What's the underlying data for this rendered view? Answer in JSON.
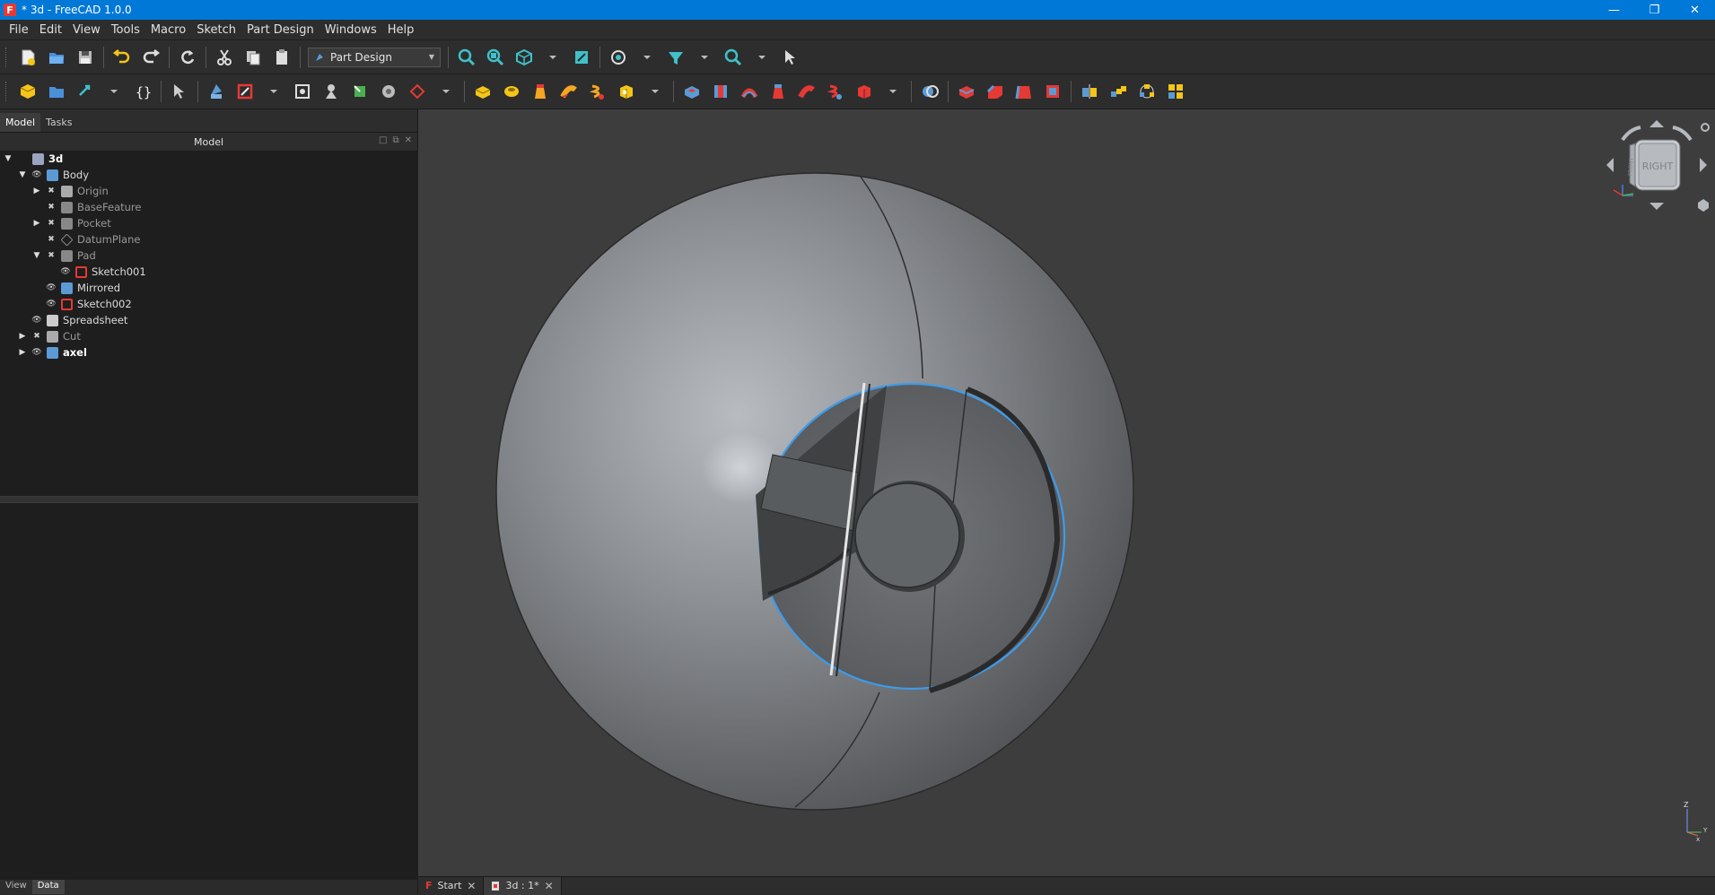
{
  "window": {
    "title": "* 3d - FreeCAD 1.0.0",
    "app_icon": "F",
    "min": "—",
    "restore": "❐",
    "close": "✕"
  },
  "menu": [
    "File",
    "Edit",
    "View",
    "Tools",
    "Macro",
    "Sketch",
    "Part Design",
    "Windows",
    "Help"
  ],
  "toolbar": {
    "workbench": "Part Design",
    "workbench_arrow": "▼"
  },
  "panel": {
    "tabs": [
      "Model",
      "Tasks"
    ],
    "title": "Model",
    "header_buttons": [
      "□",
      "⧉",
      "✕"
    ],
    "bottom_tabs": [
      "View",
      "Data"
    ]
  },
  "tree": [
    {
      "label": "3d",
      "arrow": "▼",
      "eye": "",
      "icon": "doc",
      "color": "#9aa4c0"
    },
    {
      "label": "Body",
      "arrow": "▼",
      "eye": "👁",
      "icon": "body",
      "color": "#5b9bd5"
    },
    {
      "label": "Origin",
      "arrow": "▶",
      "eye": "✖",
      "icon": "origin",
      "color": "#aaaaaa"
    },
    {
      "label": "BaseFeature",
      "arrow": "",
      "eye": "✖",
      "icon": "feature",
      "color": "#888888"
    },
    {
      "label": "Pocket",
      "arrow": "▶",
      "eye": "✖",
      "icon": "pocket",
      "color": "#888888"
    },
    {
      "label": "DatumPlane",
      "arrow": "",
      "eye": "✖",
      "icon": "plane",
      "color": "#aaaaaa"
    },
    {
      "label": "Pad",
      "arrow": "▼",
      "eye": "✖",
      "icon": "pad",
      "color": "#888888"
    },
    {
      "label": "Sketch001",
      "arrow": "",
      "eye": "👁",
      "icon": "sketch",
      "color": "#e53935"
    },
    {
      "label": "Mirrored",
      "arrow": "",
      "eye": "👁",
      "icon": "mirror",
      "color": "#5b9bd5"
    },
    {
      "label": "Sketch002",
      "arrow": "",
      "eye": "👁",
      "icon": "sketch",
      "color": "#e53935"
    },
    {
      "label": "Spreadsheet",
      "arrow": "",
      "eye": "👁",
      "icon": "sheet",
      "color": "#cccccc"
    },
    {
      "label": "Cut",
      "arrow": "▶",
      "eye": "✖",
      "icon": "cut",
      "color": "#aaaaaa"
    },
    {
      "label": "axel",
      "arrow": "▶",
      "eye": "👁",
      "icon": "body",
      "color": "#5b9bd5"
    }
  ],
  "navcube": {
    "face": "RIGHT",
    "side": "FRONT"
  },
  "axes": {
    "x": "x",
    "y": "Y",
    "z": "Z"
  },
  "doc_tabs": [
    {
      "label": "Start",
      "icon": "F",
      "close": "✕"
    },
    {
      "label": "3d : 1*",
      "icon": "3d",
      "close": "✕"
    }
  ],
  "colors": {
    "selection": "#3d9be9",
    "accent": "#0078d7",
    "sketch": "#e53935"
  }
}
